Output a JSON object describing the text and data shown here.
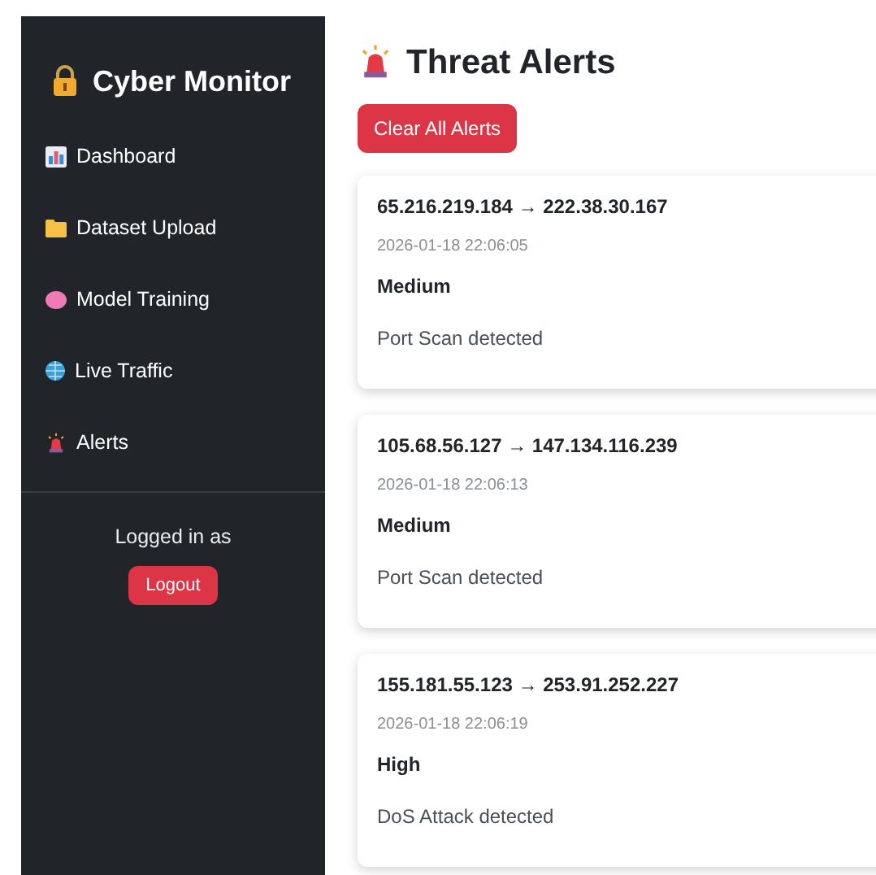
{
  "sidebar": {
    "brand": "Cyber Monitor",
    "items": [
      {
        "label": "Dashboard"
      },
      {
        "label": "Dataset Upload"
      },
      {
        "label": "Model Training"
      },
      {
        "label": "Live Traffic"
      },
      {
        "label": "Alerts"
      }
    ],
    "logged_in_label": "Logged in as",
    "logout_button": "Logout"
  },
  "main": {
    "title": "Threat Alerts",
    "clear_button": "Clear All Alerts",
    "alerts": [
      {
        "route": "65.216.219.184 → 222.38.30.167",
        "time": "2026-01-18 22:06:05",
        "severity": "Medium",
        "message": "Port Scan detected"
      },
      {
        "route": "105.68.56.127 → 147.134.116.239",
        "time": "2026-01-18 22:06:13",
        "severity": "Medium",
        "message": "Port Scan detected"
      },
      {
        "route": "155.181.55.123 → 253.91.252.227",
        "time": "2026-01-18 22:06:19",
        "severity": "High",
        "message": "DoS Attack detected"
      }
    ]
  }
}
